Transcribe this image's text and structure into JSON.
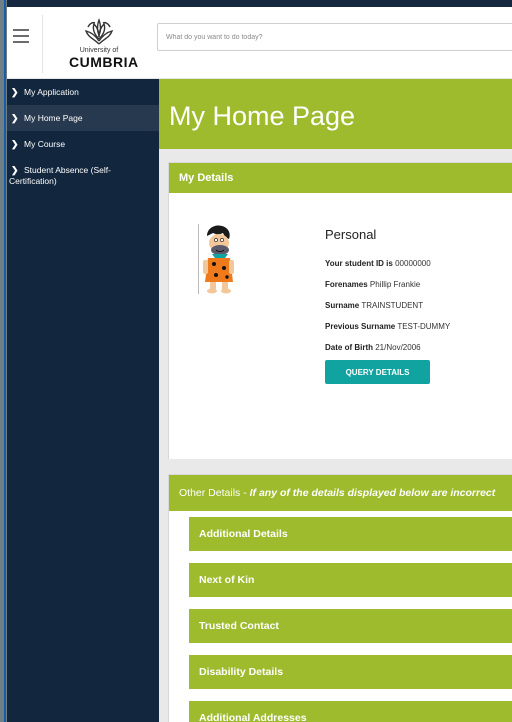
{
  "header": {
    "logo_top": "University of",
    "logo_bottom": "CUMBRIA",
    "search_placeholder": "What do you want to do today?"
  },
  "sidebar": {
    "items": [
      {
        "label": "My Application"
      },
      {
        "label": "My Home Page"
      },
      {
        "label": "My Course"
      },
      {
        "label": "Student Absence (Self-Certification)"
      }
    ]
  },
  "main": {
    "page_title": "My Home Page",
    "details": {
      "heading": "My Details",
      "section_title": "Personal",
      "id_label": "Your student ID is",
      "id_value": "00000000",
      "forenames_label": "Forenames",
      "forenames_value": "Phillip Frankie",
      "surname_label": "Surname",
      "surname_value": "TRAINSTUDENT",
      "prev_surname_label": "Previous Surname",
      "prev_surname_value": "TEST-DUMMY",
      "dob_label": "Date of Birth",
      "dob_value": "21/Nov/2006",
      "query_button": "QUERY DETAILS"
    },
    "other": {
      "heading": "Other Details - ",
      "warning": "If any of the details displayed below are incorrect",
      "sections": [
        "Additional Details",
        "Next of Kin",
        "Trusted Contact",
        "Disability Details",
        "Additional Addresses"
      ]
    }
  },
  "colors": {
    "accent_green": "#9dbb2d",
    "sidebar_navy": "#12263d",
    "button_teal": "#11a3a0"
  }
}
